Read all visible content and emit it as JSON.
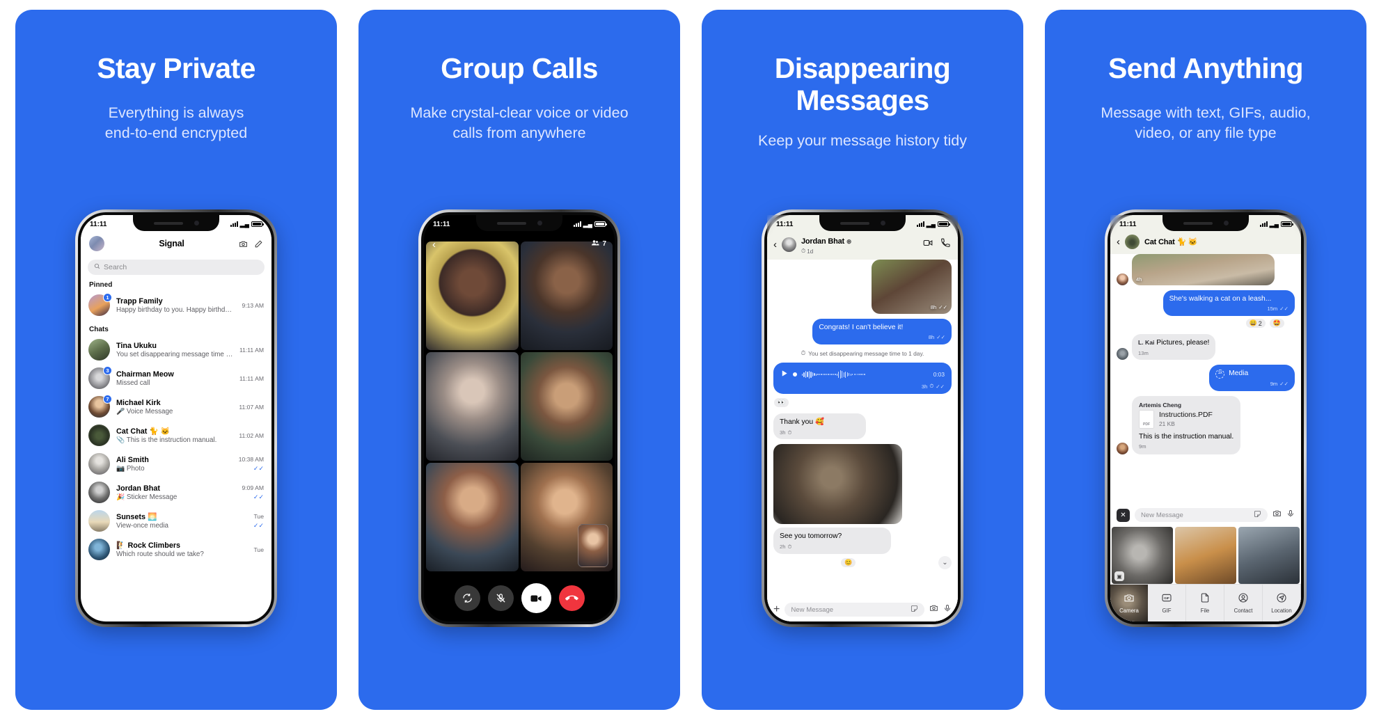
{
  "brand": {
    "blue": "#2c6bed",
    "panel_bg": "#2c6bed",
    "bubble_out": "#2c6bed",
    "bubble_in": "#e9e9eb"
  },
  "panels": [
    {
      "title": "Stay Private",
      "subtitle": "Everything is always\nend-to-end encrypted",
      "status_time": "11:11",
      "app_title": "Signal",
      "search_placeholder": "Search",
      "sections": [
        {
          "label": "Pinned"
        },
        {
          "label": "Chats"
        }
      ],
      "pinned": [
        {
          "name": "Trapp Family",
          "preview": "Happy birthday to you. Happy birthday to...",
          "time": "9:13 AM",
          "badge": "1",
          "check": false
        }
      ],
      "chats": [
        {
          "name": "Tina Ukuku",
          "preview": "You set disappearing message time to 1 day.",
          "time": "11:11 AM",
          "badge": "",
          "check": false
        },
        {
          "name": "Chairman Meow",
          "preview": "Missed call",
          "time": "11:11 AM",
          "badge": "3",
          "check": false
        },
        {
          "name": "Michael Kirk",
          "preview": "🎤 Voice Message",
          "time": "11:07 AM",
          "badge": "7",
          "check": false
        },
        {
          "name": "Cat Chat 🐈 🐱",
          "preview": "📎 This is the instruction manual.",
          "time": "11:02 AM",
          "badge": "",
          "check": false
        },
        {
          "name": "Ali Smith",
          "preview": "📷 Photo",
          "time": "10:38 AM",
          "badge": "",
          "check": true
        },
        {
          "name": "Jordan Bhat",
          "preview": "🎉 Sticker Message",
          "time": "9:09 AM",
          "badge": "",
          "check": true
        },
        {
          "name": "Sunsets 🌅",
          "preview": "View-once media",
          "time": "Tue",
          "badge": "",
          "check": true
        },
        {
          "name": "🧗 Rock Climbers",
          "preview": "Which route should we take?",
          "time": "Tue",
          "badge": "",
          "check": false
        }
      ]
    },
    {
      "title": "Group Calls",
      "subtitle": "Make crystal-clear voice or video\ncalls from anywhere",
      "status_time": "11:11",
      "participant_count": "7",
      "controls": [
        {
          "name": "flip-camera-button",
          "icon": "flip"
        },
        {
          "name": "mute-button",
          "icon": "mic-off"
        },
        {
          "name": "video-button",
          "icon": "video"
        },
        {
          "name": "end-call-button",
          "icon": "hangup"
        }
      ]
    },
    {
      "title": "Disappearing\nMessages",
      "subtitle": "Keep your message history tidy",
      "status_time": "11:11",
      "contact_name": "Jordan Bhat",
      "contact_timer": "1d",
      "messages": [
        {
          "kind": "media-out",
          "time": "8h",
          "check": true
        },
        {
          "kind": "out",
          "text": "Congrats! I can't believe it!",
          "time": "8h",
          "check": true
        },
        {
          "kind": "system",
          "text": "You set disappearing message time to 1 day."
        },
        {
          "kind": "voice-out",
          "duration": "0:03",
          "time": "3h",
          "check": true,
          "reaction": "👀"
        },
        {
          "kind": "in",
          "text": "Thank you 🥰",
          "time": "3h",
          "check": false
        },
        {
          "kind": "media-in"
        },
        {
          "kind": "in",
          "text": "See you tomorrow?",
          "time": "2h",
          "check": false,
          "reaction": "😊"
        }
      ],
      "composer_placeholder": "New Message"
    },
    {
      "title": "Send Anything",
      "subtitle": "Message with text, GIFs, audio,\nvideo, or any file type",
      "status_time": "11:11",
      "contact_name": "Cat Chat 🐈 🐱",
      "messages": [
        {
          "kind": "media-in",
          "time": "4h"
        },
        {
          "kind": "out",
          "text": "She's walking a cat on a leash...",
          "time": "15m",
          "check": true,
          "reactions": [
            {
              "emoji": "😄",
              "count": "2"
            },
            {
              "emoji": "🤩",
              "count": ""
            }
          ]
        },
        {
          "kind": "in",
          "sender": "L. Kai",
          "text": "Pictures, please!",
          "time": "13m"
        },
        {
          "kind": "media-pill-out",
          "label": "Media",
          "time": "9m",
          "check": true,
          "viewonce": "1x"
        },
        {
          "kind": "file-in",
          "sender": "Artemis Cheng",
          "filename": "Instructions.PDF",
          "filesize": "21 KB",
          "text": "This is the instruction manual.",
          "time": "9m"
        }
      ],
      "composer_placeholder": "New Message",
      "attachment_items": [
        {
          "label": "Camera",
          "icon": "camera-icon"
        },
        {
          "label": "GIF",
          "icon": "gif-icon"
        },
        {
          "label": "File",
          "icon": "file-icon"
        },
        {
          "label": "Contact",
          "icon": "contact-icon"
        },
        {
          "label": "Location",
          "icon": "location-icon"
        }
      ]
    }
  ]
}
